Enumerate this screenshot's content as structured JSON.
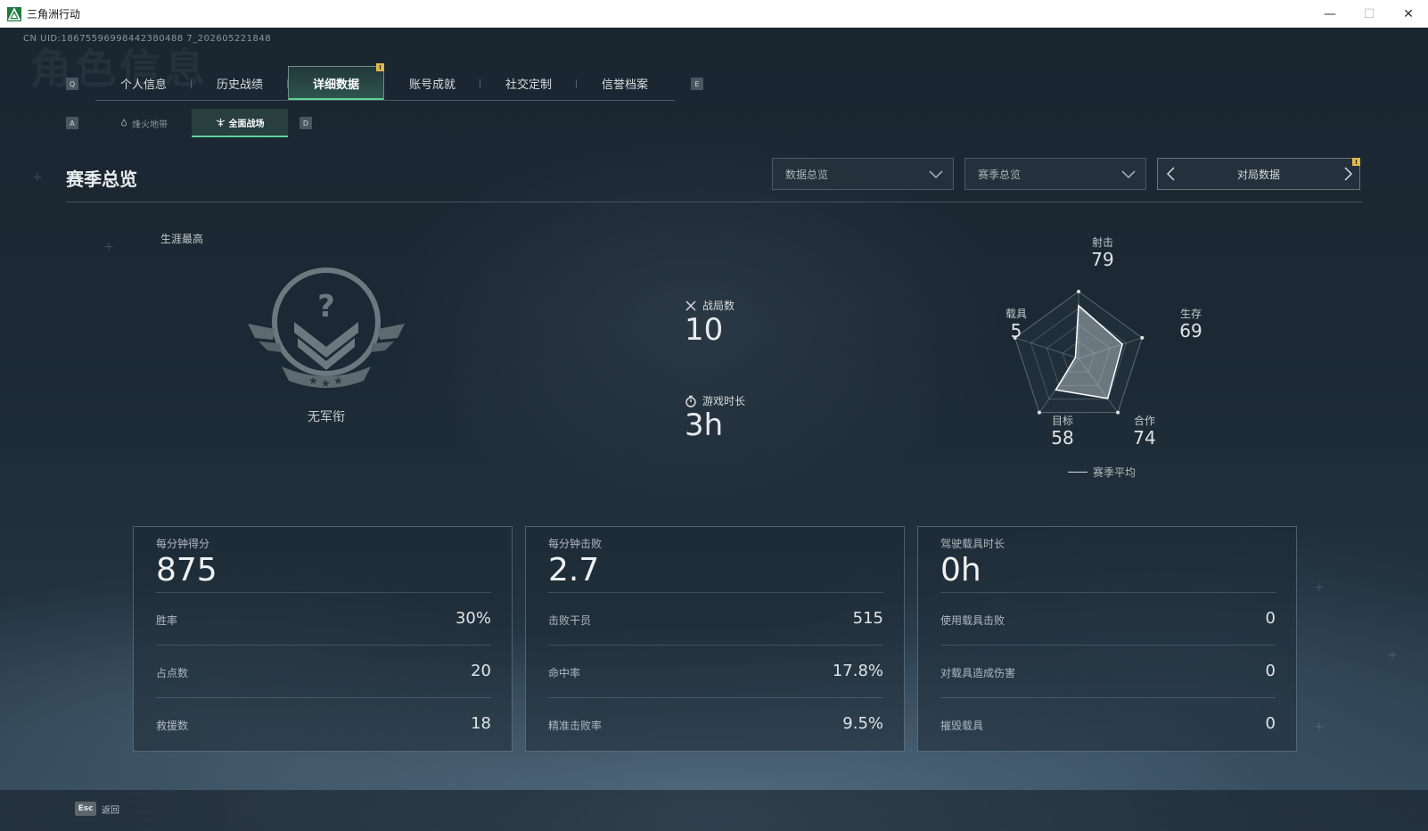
{
  "window": {
    "title": "三角洲行动",
    "minimize": "—",
    "maximize": "☐",
    "close": "✕"
  },
  "header": {
    "uid": "CN UID:18675596998442380488 7_202605221848",
    "watermark": "角色信息"
  },
  "tabs": {
    "prev_key": "Q",
    "next_key": "E",
    "items": [
      {
        "label": "个人信息"
      },
      {
        "label": "历史战绩"
      },
      {
        "label": "详细数据"
      },
      {
        "label": "账号成就"
      },
      {
        "label": "社交定制"
      },
      {
        "label": "信誉档案"
      }
    ],
    "active_index": 2,
    "notif": "!"
  },
  "subtabs": {
    "prev_key": "A",
    "next_key": "D",
    "items": [
      {
        "label": "烽火地带",
        "icon": "flame-icon"
      },
      {
        "label": "全面战场",
        "icon": "battlefield-icon"
      }
    ],
    "active_index": 1
  },
  "section": {
    "title": "赛季总览"
  },
  "filters": {
    "data_dropdown": "数据总览",
    "season_dropdown": "赛季总览",
    "pager_label": "对局数据",
    "pager_notif": "!"
  },
  "career": {
    "label": "生涯最高",
    "rank_name": "无军衔"
  },
  "summary": {
    "matches_label": "战局数",
    "matches_value": "10",
    "playtime_label": "游戏时长",
    "playtime_value": "3h"
  },
  "radar": {
    "axes": [
      {
        "label": "射击",
        "value": "79"
      },
      {
        "label": "生存",
        "value": "69"
      },
      {
        "label": "合作",
        "value": "74"
      },
      {
        "label": "目标",
        "value": "58"
      },
      {
        "label": "载具",
        "value": "5"
      }
    ],
    "legend": "赛季平均"
  },
  "panels": [
    {
      "title": "每分钟得分",
      "value": "875",
      "rows": [
        {
          "label": "胜率",
          "value": "30%"
        },
        {
          "label": "占点数",
          "value": "20"
        },
        {
          "label": "救援数",
          "value": "18"
        }
      ]
    },
    {
      "title": "每分钟击败",
      "value": "2.7",
      "rows": [
        {
          "label": "击败干员",
          "value": "515"
        },
        {
          "label": "命中率",
          "value": "17.8%"
        },
        {
          "label": "精准击败率",
          "value": "9.5%"
        }
      ]
    },
    {
      "title": "驾驶载具时长",
      "value": "0h",
      "rows": [
        {
          "label": "使用载具击败",
          "value": "0"
        },
        {
          "label": "对载具造成伤害",
          "value": "0"
        },
        {
          "label": "摧毁载具",
          "value": "0"
        }
      ]
    }
  ],
  "footer": {
    "esc_key": "Esc",
    "back_label": "返回"
  }
}
